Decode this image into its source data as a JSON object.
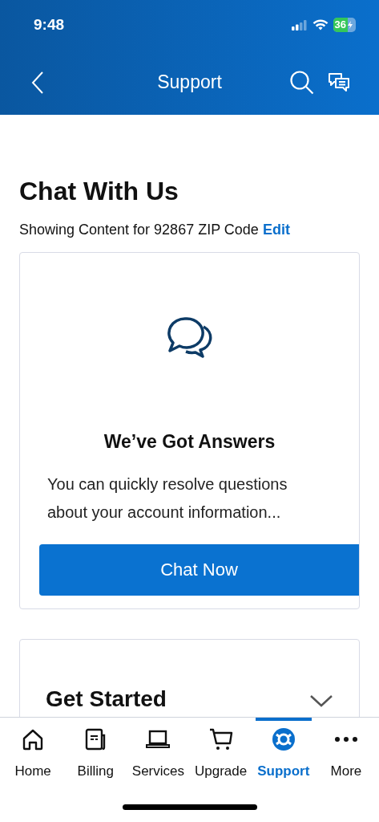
{
  "status_bar": {
    "time": "9:48",
    "battery": "36"
  },
  "header": {
    "title": "Support"
  },
  "page": {
    "title": "Chat With Us",
    "location_text": "Showing Content for 92867 ZIP Code",
    "edit_link": "Edit"
  },
  "chat_card": {
    "heading": "We’ve Got Answers",
    "body": "You can quickly resolve questions about your account information...",
    "button": "Chat Now"
  },
  "next_card": {
    "heading": "Get Started"
  },
  "tab_bar": [
    {
      "kind": "home",
      "label": "Home",
      "selected": false
    },
    {
      "kind": "billing",
      "label": "Billing",
      "selected": false
    },
    {
      "kind": "services",
      "label": "Services",
      "selected": false
    },
    {
      "kind": "upgrade",
      "label": "Upgrade",
      "selected": false
    },
    {
      "kind": "support",
      "label": "Support",
      "selected": true
    },
    {
      "kind": "more",
      "label": "More",
      "selected": false
    }
  ]
}
